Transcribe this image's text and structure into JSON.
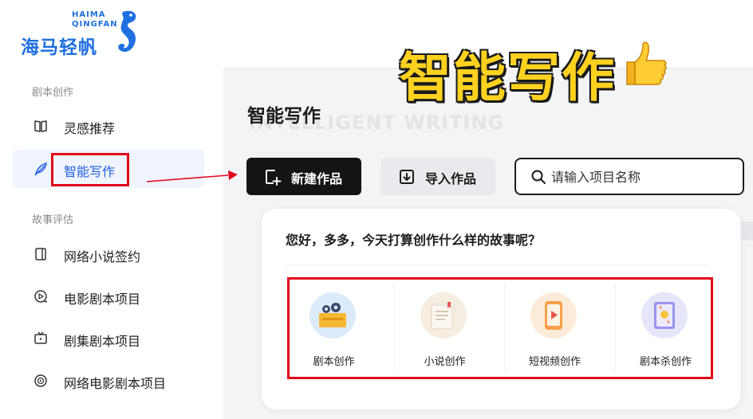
{
  "brand": {
    "name_cn": "海马轻帆",
    "name_en_line1": "HAIMA",
    "name_en_line2": "QINGFAN",
    "color": "#1f6fe0"
  },
  "overlay": {
    "text": "智能写作",
    "icon": "thumbs-up-icon",
    "color": "#ffd21f"
  },
  "sidebar": {
    "sections": [
      {
        "title": "剧本创作",
        "items": [
          {
            "label": "灵感推荐",
            "icon": "book-open-icon",
            "active": false
          },
          {
            "label": "智能写作",
            "icon": "quill-pen-icon",
            "active": true
          }
        ]
      },
      {
        "title": "故事评估",
        "items": [
          {
            "label": "网络小说签约",
            "icon": "book-icon",
            "active": false
          },
          {
            "label": "电影剧本项目",
            "icon": "film-reel-icon",
            "active": false
          },
          {
            "label": "剧集剧本项目",
            "icon": "tv-icon",
            "active": false
          },
          {
            "label": "网络电影剧本项目",
            "icon": "play-circle-icon",
            "active": false
          }
        ]
      }
    ],
    "active_color": "#1f5fe0"
  },
  "main": {
    "title": "智能写作",
    "subtitle": "INTELLIGENT WRITING",
    "new_button": {
      "label": "新建作品",
      "icon": "plus-square-icon"
    },
    "import_button": {
      "label": "导入作品",
      "icon": "import-icon"
    },
    "search": {
      "placeholder": "请输入项目名称",
      "value": "",
      "icon": "search-icon"
    }
  },
  "card": {
    "greeting": "您好，多多，今天打算创作什么样的故事呢？",
    "options": [
      {
        "label": "剧本创作",
        "icon": "film-clapper-icon",
        "bg": "#dcebfb"
      },
      {
        "label": "小说创作",
        "icon": "notebook-icon",
        "bg": "#f6eee2"
      },
      {
        "label": "短视频创作",
        "icon": "phone-video-icon",
        "bg": "#fdebd9"
      },
      {
        "label": "剧本杀创作",
        "icon": "mystery-card-icon",
        "bg": "#e6e6fb"
      }
    ]
  },
  "highlight_color": "#e2061b"
}
